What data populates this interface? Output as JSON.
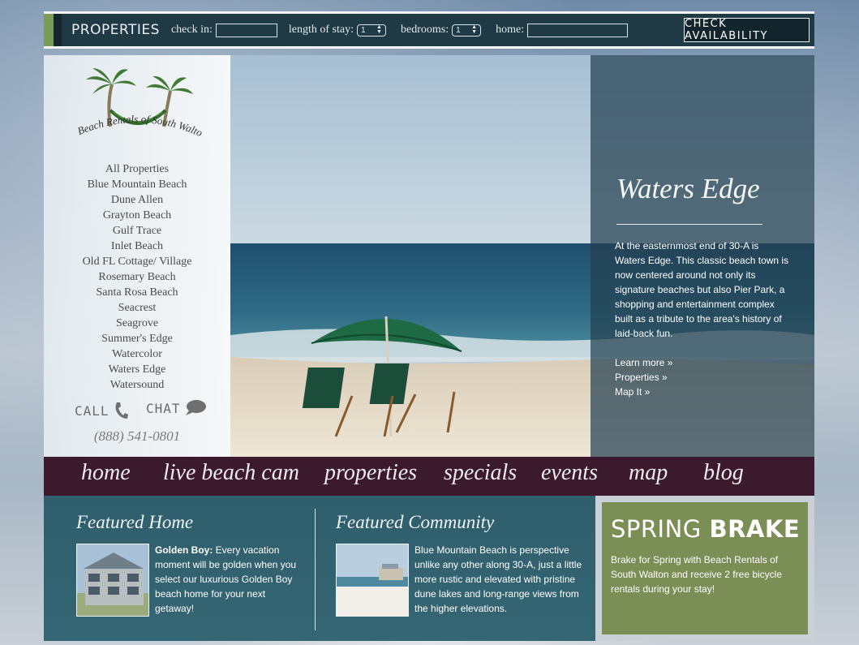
{
  "topbar": {
    "title": "PROPERTIES",
    "check_in_label": "check in:",
    "check_in_value": "",
    "length_label": "length of stay:",
    "length_value": "1",
    "bedrooms_label": "bedrooms:",
    "bedrooms_value": "1",
    "home_label": "home:",
    "home_value": "",
    "check_button": "CHECK AVAILABILITY"
  },
  "sidebar": {
    "logo_text": "Beach Rentals of South Walton",
    "items": [
      "All Properties",
      "Blue Mountain Beach",
      "Dune Allen",
      "Grayton Beach",
      "Gulf Trace",
      "Inlet Beach",
      "Old FL Cottage/ Village",
      "Rosemary Beach",
      "Santa Rosa Beach",
      "Seacrest",
      "Seagrove",
      "Summer's Edge",
      "Watercolor",
      "Waters Edge",
      "Watersound"
    ],
    "call_label": "CALL",
    "chat_label": "CHAT",
    "phone": "(888) 541-0801"
  },
  "hero": {
    "title": "Waters Edge",
    "description": "At the easternmost end of 30-A is Waters Edge. This classic beach town is now centered around not only its signature beaches but also Pier Park, a shopping and entertainment complex built as a tribute to the area's history of laid-back fun.",
    "links": [
      "Learn more »",
      "Properties »",
      "Map It »"
    ]
  },
  "mainnav": {
    "items": [
      "home",
      "live beach cam",
      "properties",
      "specials",
      "events",
      "map",
      "blog"
    ]
  },
  "featured_home": {
    "title": "Featured Home",
    "name": "Golden Boy:",
    "text": " Every vacation moment will be golden when you select our luxurious Golden Boy beach home for your next getaway!"
  },
  "featured_community": {
    "title": "Featured Community",
    "text": "Blue Mountain Beach is perspective unlike any other along 30-A, just a little more rustic and elevated with pristine dune lakes and long-range views from the higher elevations."
  },
  "promo": {
    "title_light": "SPRING",
    "title_bold": "BRAKE",
    "text": "Brake for Spring with Beach Rentals of South Walton and receive 2 free bicycle rentals during your stay!"
  },
  "colors": {
    "topbar": "#1f3a45",
    "accent_green": "#7c9a58",
    "mainnav": "#3a1a2c",
    "featured": "#2f5e6c",
    "promo": "#7a8e56"
  }
}
